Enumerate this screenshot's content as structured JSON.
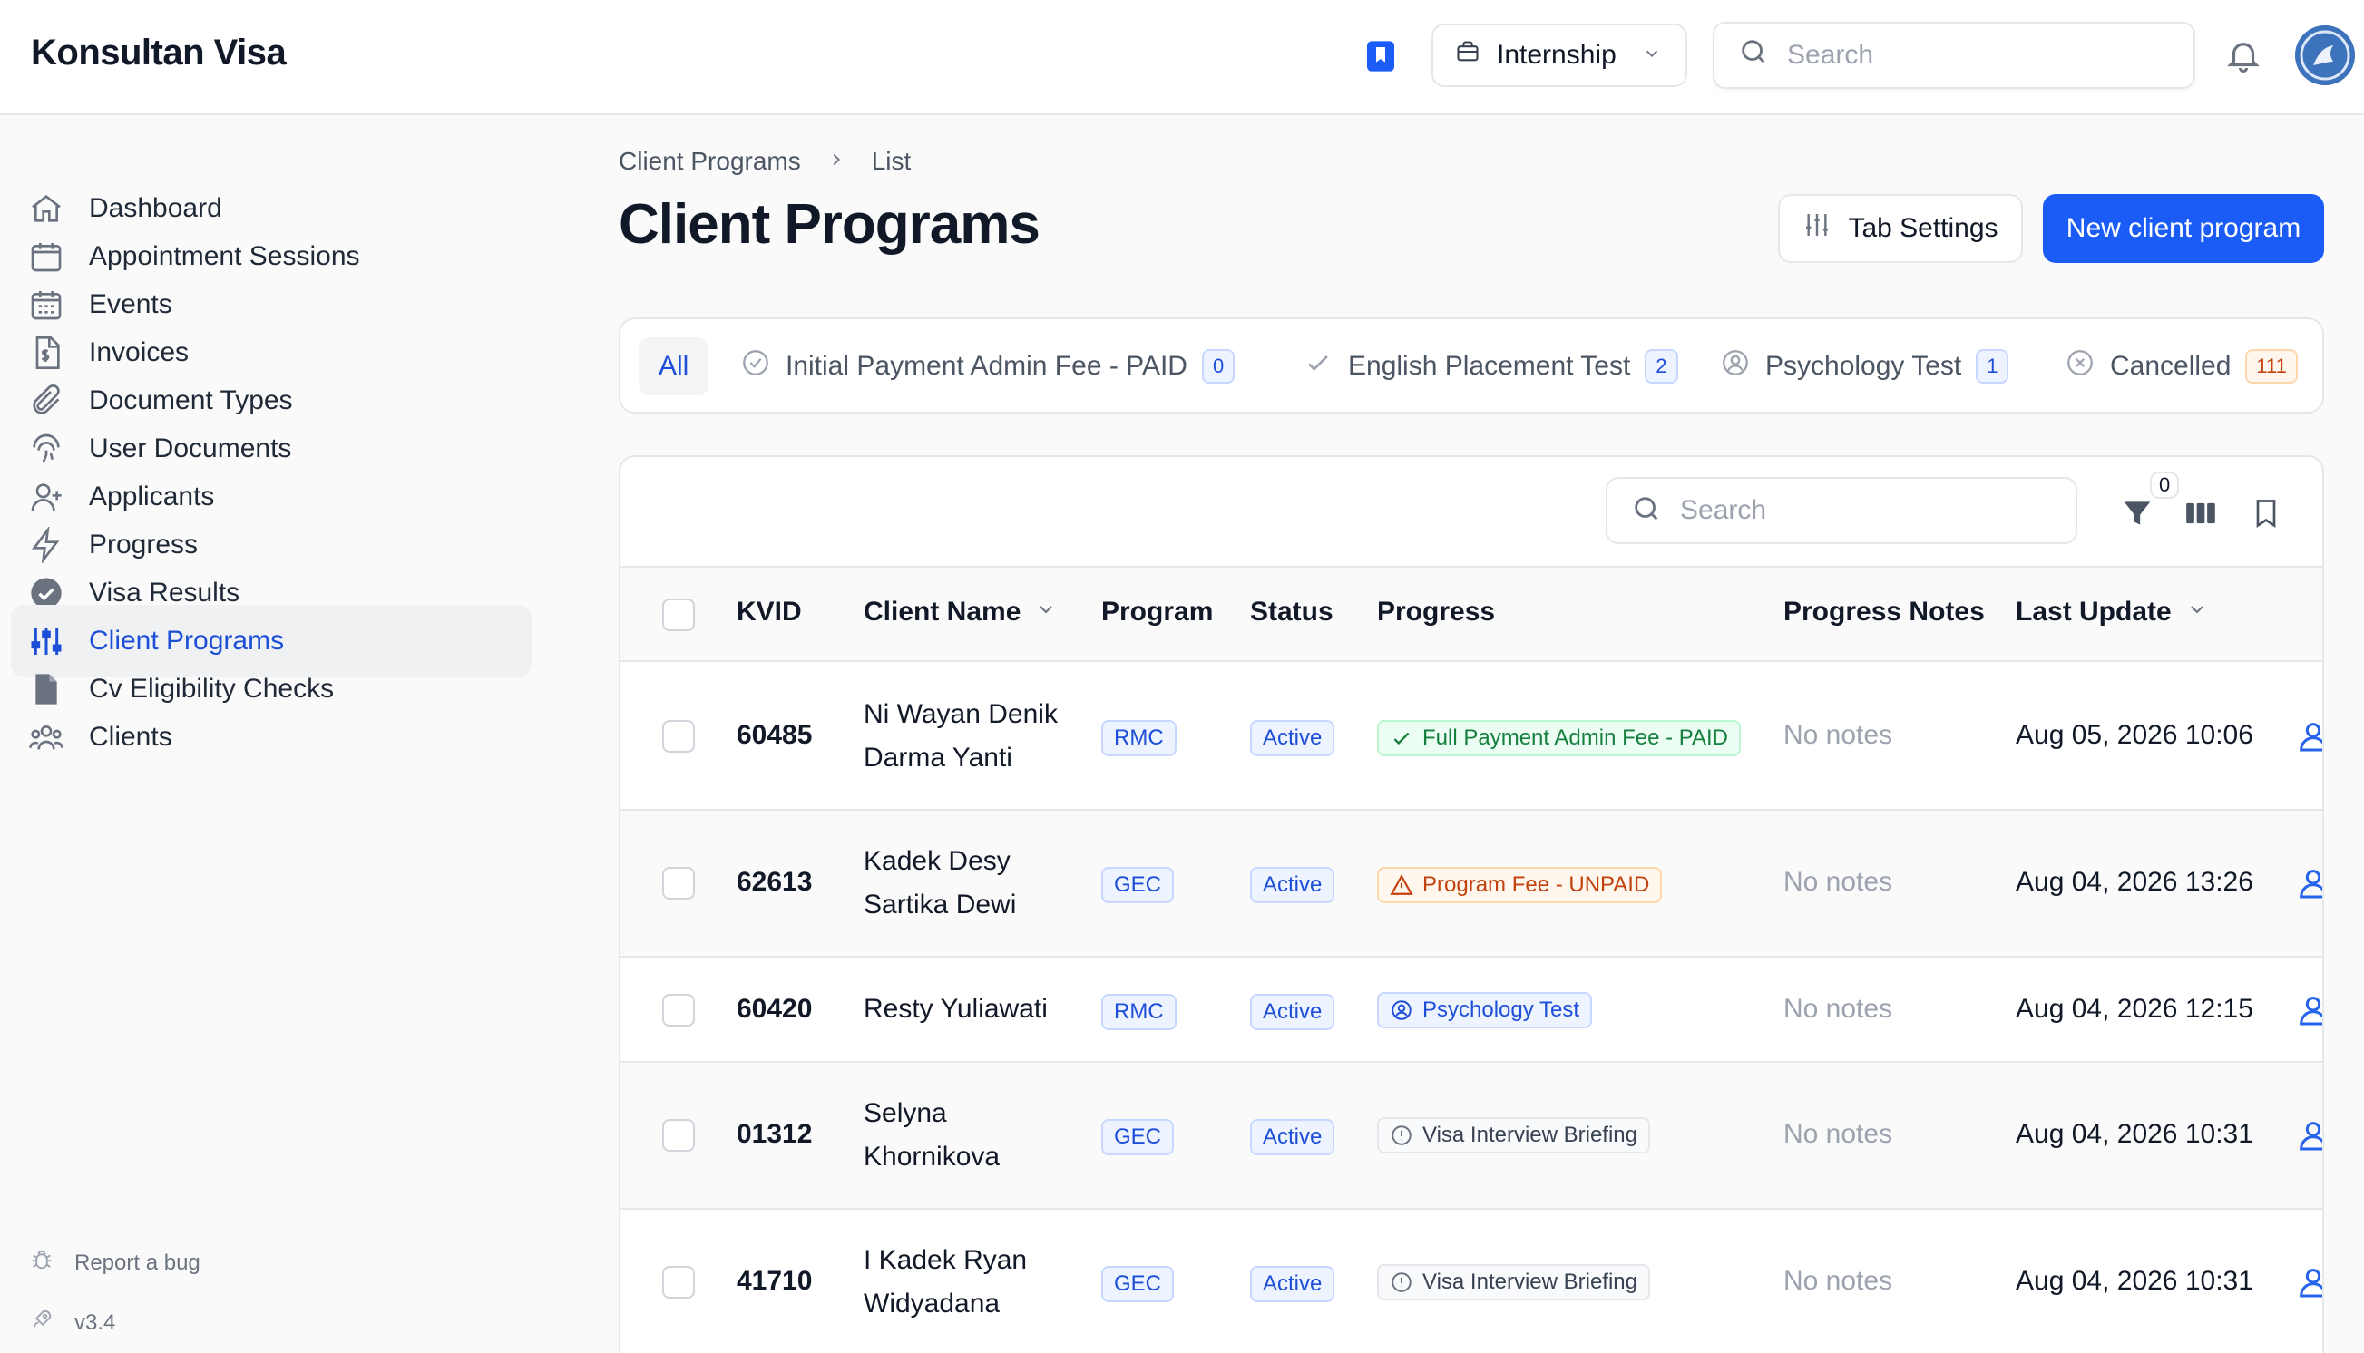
{
  "app": {
    "brand": "Konsultan Visa",
    "tenant": "Internship",
    "search_placeholder": "Search"
  },
  "sidebar": {
    "items": [
      {
        "label": "Dashboard",
        "icon": "home-icon"
      },
      {
        "label": "Appointment Sessions",
        "icon": "calendar-icon"
      },
      {
        "label": "Events",
        "icon": "calendar-days-icon"
      },
      {
        "label": "Invoices",
        "icon": "invoice-icon"
      },
      {
        "label": "Document Types",
        "icon": "paperclip-icon"
      },
      {
        "label": "User Documents",
        "icon": "fingerprint-icon"
      },
      {
        "label": "Applicants",
        "icon": "user-plus-icon"
      },
      {
        "label": "Progress",
        "icon": "bolt-icon"
      },
      {
        "label": "Visa Results",
        "icon": "check-badge-icon"
      },
      {
        "label": "Client Programs",
        "icon": "sliders-icon"
      },
      {
        "label": "Cv Eligibility Checks",
        "icon": "document-icon"
      },
      {
        "label": "Clients",
        "icon": "users-icon"
      }
    ],
    "active": "Client Programs",
    "report_bug": "Report a bug",
    "version": "v3.4"
  },
  "page": {
    "breadcrumb": [
      "Client Programs",
      "List"
    ],
    "title": "Client Programs",
    "tab_settings_label": "Tab Settings",
    "new_button_label": "New client program"
  },
  "tabs": [
    {
      "label": "All",
      "count": null,
      "active": true
    },
    {
      "label": "Initial Payment Admin Fee - PAID",
      "count": "0",
      "icon": "check-circle-icon",
      "badge": "blue"
    },
    {
      "label": "English Placement Test",
      "count": "2",
      "icon": "check-icon",
      "badge": "blue"
    },
    {
      "label": "Psychology Test",
      "count": "1",
      "icon": "user-circle-icon",
      "badge": "blue"
    },
    {
      "label": "Cancelled",
      "count": "111",
      "icon": "x-circle-icon",
      "badge": "orange"
    }
  ],
  "table": {
    "search_placeholder": "Search",
    "filter_count": "0",
    "columns": [
      "KVID",
      "Client Name",
      "Program",
      "Status",
      "Progress",
      "Progress Notes",
      "Last Update"
    ],
    "rows": [
      {
        "kvid": "60485",
        "name_line1": "Ni Wayan Denik",
        "name_line2": "Darma Yanti",
        "program": "RMC",
        "status": "Active",
        "progress": "Full Payment Admin Fee - PAID",
        "progress_style": "green",
        "notes": "No notes",
        "updated": "Aug 05, 2026 10:06"
      },
      {
        "kvid": "62613",
        "name_line1": "Kadek Desy",
        "name_line2": "Sartika Dewi",
        "program": "GEC",
        "status": "Active",
        "progress": "Program Fee - UNPAID",
        "progress_style": "orange",
        "notes": "No notes",
        "updated": "Aug 04, 2026 13:26"
      },
      {
        "kvid": "60420",
        "name_line1": "Resty Yuliawati",
        "name_line2": "",
        "program": "RMC",
        "status": "Active",
        "progress": "Psychology Test",
        "progress_style": "blue",
        "notes": "No notes",
        "updated": "Aug 04, 2026 12:15"
      },
      {
        "kvid": "01312",
        "name_line1": "Selyna",
        "name_line2": "Khornikova",
        "program": "GEC",
        "status": "Active",
        "progress": "Visa Interview Briefing",
        "progress_style": "gray",
        "notes": "No notes",
        "updated": "Aug 04, 2026 10:31"
      },
      {
        "kvid": "41710",
        "name_line1": "I Kadek Ryan",
        "name_line2": "Widyadana",
        "program": "GEC",
        "status": "Active",
        "progress": "Visa Interview Briefing",
        "progress_style": "gray",
        "notes": "No notes",
        "updated": "Aug 04, 2026 10:31"
      }
    ]
  },
  "colors": {
    "primary": "#1a5cf5",
    "active_nav_text": "#1d4ed8"
  }
}
